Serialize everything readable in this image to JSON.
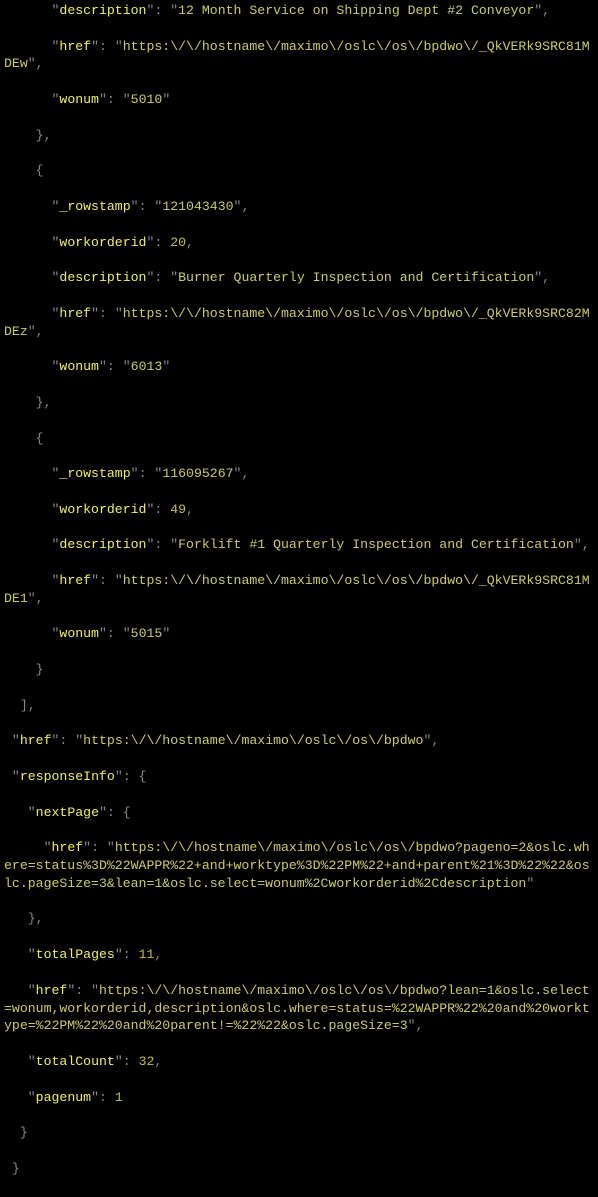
{
  "members": [
    {
      "description": "12 Month Service on Shipping Dept #2 Conveyor",
      "href": "https:\\/\\/hostname\\/maximo\\/oslc\\/os\\/bpdwo\\/_QkVERk9SRC81MDEw",
      "wonum": "5010"
    },
    {
      "_rowstamp": "121043430",
      "workorderid": 20,
      "description": "Burner Quarterly Inspection and Certification",
      "href": "https:\\/\\/hostname\\/maximo\\/oslc\\/os\\/bpdwo\\/_QkVERk9SRC82MDEz",
      "wonum": "6013"
    },
    {
      "_rowstamp": "116095267",
      "workorderid": 49,
      "description": "Forklift #1 Quarterly Inspection and Certification",
      "href": "https:\\/\\/hostname\\/maximo\\/oslc\\/os\\/bpdwo\\/_QkVERk9SRC81MDE1",
      "wonum": "5015"
    }
  ],
  "outer_href": "https:\\/\\/hostname\\/maximo\\/oslc\\/os\\/bpdwo",
  "responseInfo": {
    "nextPage": {
      "href": "https:\\/\\/hostname\\/maximo\\/oslc\\/os\\/bpdwo?pageno=2&oslc.where=status%3D%22WAPPR%22+and+worktype%3D%22PM%22+and+parent%21%3D%22%22&oslc.pageSize=3&lean=1&oslc.select=wonum%2Cworkorderid%2Cdescription"
    },
    "totalPages": 11,
    "href": "https:\\/\\/hostname\\/maximo\\/oslc\\/os\\/bpdwo?lean=1&oslc.select=wonum,workorderid,description&oslc.where=status=%22WAPPR%22%20and%20worktype=%22PM%22%20and%20parent!=%22%22&oslc.pageSize=3",
    "totalCount": 32,
    "pagenum": 1
  },
  "labels": {
    "description": "description",
    "href": "href",
    "wonum": "wonum",
    "_rowstamp": "_rowstamp",
    "workorderid": "workorderid",
    "responseInfo": "responseInfo",
    "nextPage": "nextPage",
    "totalPages": "totalPages",
    "totalCount": "totalCount",
    "pagenum": "pagenum"
  }
}
